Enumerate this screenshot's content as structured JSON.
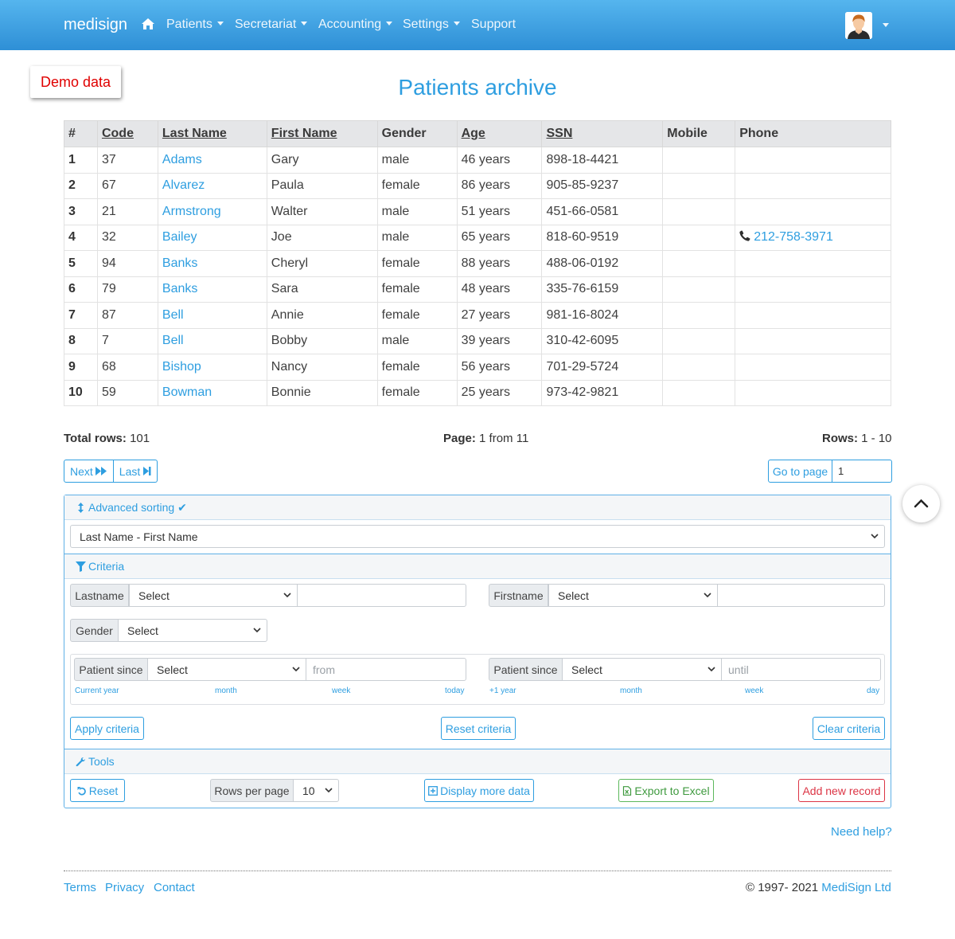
{
  "nav": {
    "brand": "medisign",
    "items": [
      "Patients",
      "Secretariat",
      "Accounting",
      "Settings",
      "Support"
    ]
  },
  "demo_badge": "Demo data",
  "page_title": "Patients archive",
  "table": {
    "headers": [
      "#",
      "Code",
      "Last Name",
      "First Name",
      "Gender",
      "Age",
      "SSN",
      "Mobile",
      "Phone"
    ],
    "rows": [
      [
        "1",
        "37",
        "Adams",
        "Gary",
        "male",
        "46 years",
        "898-18-4421",
        "",
        ""
      ],
      [
        "2",
        "67",
        "Alvarez",
        "Paula",
        "female",
        "86 years",
        "905-85-9237",
        "",
        ""
      ],
      [
        "3",
        "21",
        "Armstrong",
        "Walter",
        "male",
        "51 years",
        "451-66-0581",
        "",
        ""
      ],
      [
        "4",
        "32",
        "Bailey",
        "Joe",
        "male",
        "65 years",
        "818-60-9519",
        "",
        "212-758-3971"
      ],
      [
        "5",
        "94",
        "Banks",
        "Cheryl",
        "female",
        "88 years",
        "488-06-0192",
        "",
        ""
      ],
      [
        "6",
        "79",
        "Banks",
        "Sara",
        "female",
        "48 years",
        "335-76-6159",
        "",
        ""
      ],
      [
        "7",
        "87",
        "Bell",
        "Annie",
        "female",
        "27 years",
        "981-16-8024",
        "",
        ""
      ],
      [
        "8",
        "7",
        "Bell",
        "Bobby",
        "male",
        "39 years",
        "310-42-6095",
        "",
        ""
      ],
      [
        "9",
        "68",
        "Bishop",
        "Nancy",
        "female",
        "56 years",
        "701-29-5724",
        "",
        ""
      ],
      [
        "10",
        "59",
        "Bowman",
        "Bonnie",
        "female",
        "25 years",
        "973-42-9821",
        "",
        ""
      ]
    ]
  },
  "summary": {
    "total_label": "Total rows:",
    "total_value": "101",
    "page_label": "Page:",
    "page_value": "1 from 11",
    "rows_label": "Rows:",
    "rows_value": "1 - 10"
  },
  "pager": {
    "next": "Next",
    "last": "Last",
    "goto": "Go to page",
    "goto_value": "1"
  },
  "sorting": {
    "title": "Advanced sorting ✔",
    "selected": "Last Name - First Name"
  },
  "criteria": {
    "title": "Criteria",
    "lastname_label": "Lastname",
    "lastname_select": "Select",
    "firstname_label": "Firstname",
    "firstname_select": "Select",
    "gender_label": "Gender",
    "gender_select": "Select",
    "since_label": "Patient since",
    "since_select": "Select",
    "from_placeholder": "from",
    "until_label": "Patient since",
    "until_select": "Select",
    "until_placeholder": "until",
    "from_shortcuts": [
      "Current year",
      "month",
      "week",
      "today"
    ],
    "until_shortcuts": [
      "+1 year",
      "month",
      "week",
      "day"
    ],
    "apply": "Apply criteria",
    "reset": "Reset criteria",
    "clear": "Clear criteria"
  },
  "tools": {
    "title": "Tools",
    "reset": "Reset",
    "rows_per_page_label": "Rows per page",
    "rows_per_page_value": "10",
    "display_more": "Display more data",
    "export": "Export to Excel",
    "add_new": "Add new record"
  },
  "need_help": "Need help?",
  "footer": {
    "links": [
      "Terms",
      "Privacy",
      "Contact"
    ],
    "copyright": "© 1997- 2021",
    "company": "MediSign Ltd"
  },
  "colors": {
    "accent": "#2e9ee0",
    "navbar_top": "#55b5ee",
    "navbar_bottom": "#2e8fd6",
    "demo_red": "#e00000"
  }
}
